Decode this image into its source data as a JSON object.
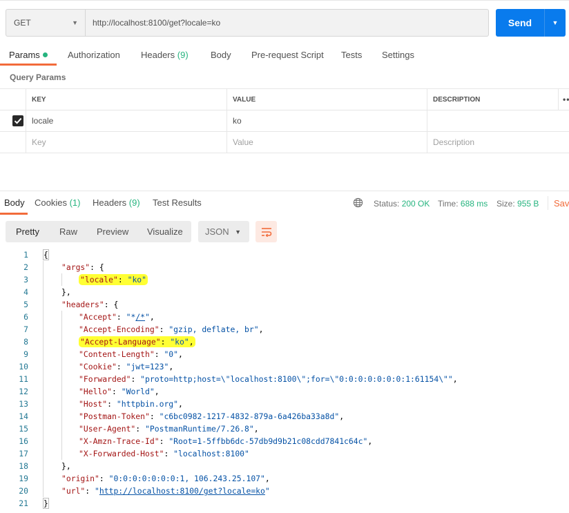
{
  "request": {
    "method": "GET",
    "url": "http://localhost:8100/get?locale=ko",
    "send_label": "Send"
  },
  "request_tabs": [
    {
      "label": "Params",
      "count": ""
    },
    {
      "label": "Authorization",
      "count": ""
    },
    {
      "label": "Headers",
      "count": "(9)"
    },
    {
      "label": "Body",
      "count": ""
    },
    {
      "label": "Pre-request Script",
      "count": ""
    },
    {
      "label": "Tests",
      "count": ""
    },
    {
      "label": "Settings",
      "count": ""
    }
  ],
  "query_params": {
    "title": "Query Params",
    "headers": {
      "key": "KEY",
      "value": "VALUE",
      "description": "DESCRIPTION"
    },
    "rows": [
      {
        "key": "locale",
        "value": "ko",
        "description": "",
        "checked": true
      }
    ],
    "placeholders": {
      "key": "Key",
      "value": "Value",
      "description": "Description"
    }
  },
  "response_tabs": [
    {
      "label": "Body",
      "count": ""
    },
    {
      "label": "Cookies",
      "count": "(1)"
    },
    {
      "label": "Headers",
      "count": "(9)"
    },
    {
      "label": "Test Results",
      "count": ""
    }
  ],
  "response_meta": {
    "status_label": "Status:",
    "status": "200 OK",
    "time_label": "Time:",
    "time": "688 ms",
    "size_label": "Size:",
    "size": "955 B",
    "save_label": "Save"
  },
  "view_modes": [
    "Pretty",
    "Raw",
    "Preview",
    "Visualize"
  ],
  "format": "JSON",
  "body_lines": [
    {
      "n": "1",
      "text": "{"
    },
    {
      "n": "2",
      "text": "\"args\": {"
    },
    {
      "n": "3",
      "text": "\"locale\": \"ko\""
    },
    {
      "n": "4",
      "text": "},"
    },
    {
      "n": "5",
      "text": "\"headers\": {"
    },
    {
      "n": "6",
      "text": "\"Accept\": \"*/*\","
    },
    {
      "n": "7",
      "text": "\"Accept-Encoding\": \"gzip, deflate, br\","
    },
    {
      "n": "8",
      "text": "\"Accept-Language\": \"ko\","
    },
    {
      "n": "9",
      "text": "\"Content-Length\": \"0\","
    },
    {
      "n": "10",
      "text": "\"Cookie\": \"jwt=123\","
    },
    {
      "n": "11",
      "text": "\"Forwarded\": \"proto=http;host=\\\"localhost:8100\\\";for=\\\"0:0:0:0:0:0:0:1:61154\\\"\","
    },
    {
      "n": "12",
      "text": "\"Hello\": \"World\","
    },
    {
      "n": "13",
      "text": "\"Host\": \"httpbin.org\","
    },
    {
      "n": "14",
      "text": "\"Postman-Token\": \"c6bc0982-1217-4832-879a-6a426ba33a8d\","
    },
    {
      "n": "15",
      "text": "\"User-Agent\": \"PostmanRuntime/7.26.8\","
    },
    {
      "n": "16",
      "text": "\"X-Amzn-Trace-Id\": \"Root=1-5ffbb6dc-57db9d9b21c08cdd7841c64c\","
    },
    {
      "n": "17",
      "text": "\"X-Forwarded-Host\": \"localhost:8100\""
    },
    {
      "n": "18",
      "text": "},"
    },
    {
      "n": "19",
      "text": "\"origin\": \"0:0:0:0:0:0:0:1, 106.243.25.107\","
    },
    {
      "n": "20",
      "text": "\"url\": \"http://localhost:8100/get?locale=ko\""
    },
    {
      "n": "21",
      "text": "}"
    }
  ],
  "colors": {
    "accent": "#f26b3a",
    "send": "#097bed",
    "success": "#26b47f",
    "highlight": "#ffff33"
  }
}
